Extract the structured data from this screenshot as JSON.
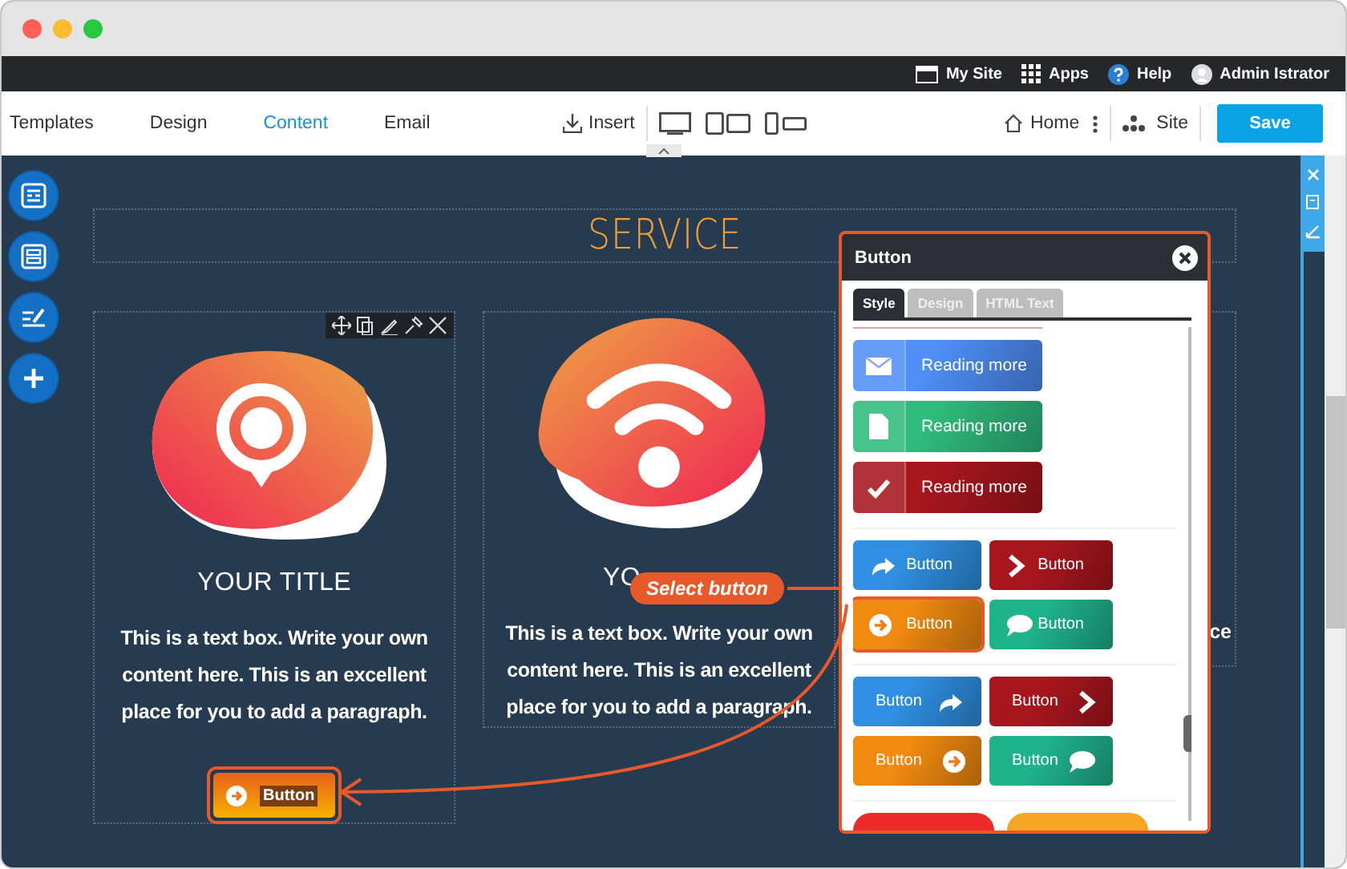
{
  "admin_bar": [
    {
      "label": "My Site"
    },
    {
      "label": "Apps"
    },
    {
      "label": "Help"
    },
    {
      "label": "Admin Istrator"
    }
  ],
  "editor_tabs": [
    {
      "label": "Templates",
      "selected": false
    },
    {
      "label": "Design",
      "selected": false
    },
    {
      "label": "Content",
      "selected": true
    },
    {
      "label": "Email",
      "selected": false
    }
  ],
  "toolbar": {
    "insert": "Insert",
    "home": "Home",
    "site": "Site",
    "save": "Save"
  },
  "page": {
    "heading": "SERVICE",
    "cards": [
      {
        "kind": "pin",
        "title": "YOUR TITLE",
        "text": "This is a text box. Write your own content here. This is an excellent place for you to add a paragraph.",
        "button": {
          "label": "Button",
          "highlighted": true
        }
      },
      {
        "kind": "wifi",
        "title": "YO",
        "text": "This is a text box. Write your own content here. This is an excellent place for you to add a paragraph."
      },
      {
        "kind": "hidden",
        "text": "ce"
      }
    ]
  },
  "panel": {
    "title": "Button",
    "tabs": [
      {
        "label": "Style",
        "selected": true
      },
      {
        "label": "Design",
        "selected": false
      },
      {
        "label": "HTML Text",
        "selected": false
      }
    ],
    "groups": [
      {
        "kind": "split",
        "items": [
          {
            "label": "Reading more",
            "color": "#4f8ff7",
            "selected": false
          },
          {
            "label": "Reading more",
            "color": "#2fbb7c",
            "selected": false
          },
          {
            "label": "Reading more",
            "color": "#a8161e",
            "selected": false
          }
        ]
      },
      {
        "kind": "icon-left",
        "items": [
          {
            "label": "Button",
            "color": "#2f8fe0",
            "selected": false
          },
          {
            "label": "Button",
            "color": "#a8161e",
            "selected": false
          },
          {
            "label": "Button",
            "color": "#f08a10",
            "selected": true
          },
          {
            "label": "Button",
            "color": "#1fb38a",
            "selected": false
          }
        ]
      },
      {
        "kind": "icon-right",
        "items": [
          {
            "label": "Button",
            "color": "#2f8fe0",
            "selected": false
          },
          {
            "label": "Button",
            "color": "#a8161e",
            "selected": false
          },
          {
            "label": "Button",
            "color": "#f08a10",
            "selected": false
          },
          {
            "label": "Button",
            "color": "#1fb38a",
            "selected": false
          }
        ]
      },
      {
        "kind": "round",
        "items": [
          {
            "color": "#ee2b2b",
            "selected": false
          },
          {
            "color": "#f5a623",
            "selected": false
          }
        ]
      }
    ]
  },
  "callout": {
    "label": "Select button"
  }
}
